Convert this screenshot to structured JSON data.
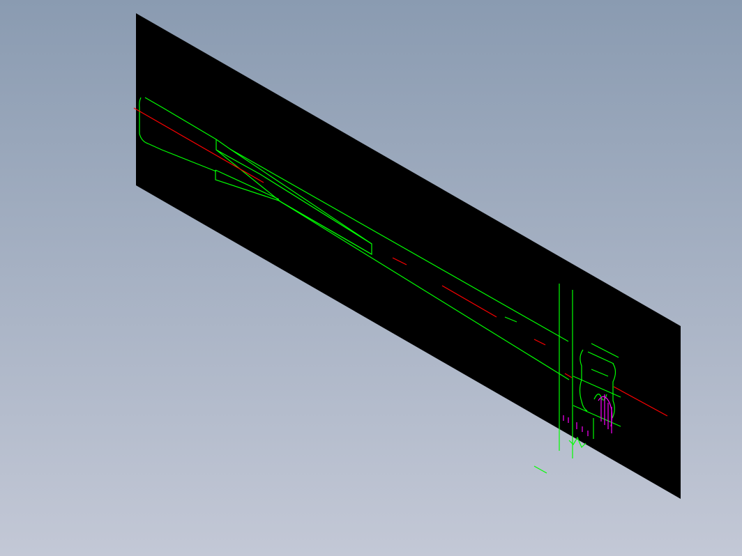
{
  "viewport": {
    "background_top": "#8a9bb1",
    "background_bottom": "#c3c8d6",
    "view": "isometric"
  },
  "drawing_sheet": {
    "fill": "#000000"
  },
  "colors": {
    "outline": "#00ff00",
    "centerline": "#ff0000",
    "hidden": "#ff00ff"
  },
  "components": [
    "drawing-sheet",
    "part-outline",
    "slot-upper",
    "slot-lower",
    "centerline",
    "vertical-lines",
    "end-detail",
    "hidden-lines",
    "stray-stroke"
  ]
}
